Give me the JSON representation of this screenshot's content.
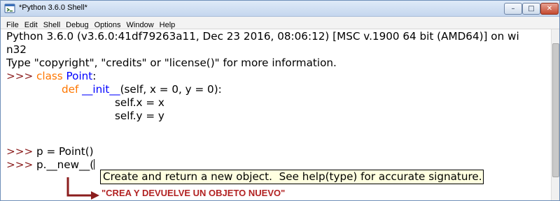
{
  "window": {
    "title": "*Python 3.6.0 Shell*",
    "buttons": {
      "minimize": "–",
      "maximize": "□",
      "close": "✕"
    }
  },
  "menu": [
    "File",
    "Edit",
    "Shell",
    "Debug",
    "Options",
    "Window",
    "Help"
  ],
  "shell": {
    "banner_line1": "Python 3.6.0 (v3.6.0:41df79263a11, Dec 23 2016, 08:06:12) [MSC v.1900 64 bit (AMD64)] on wi",
    "banner_line2": "n32",
    "banner_line3": "Type \"copyright\", \"credits\" or \"license()\" for more information.",
    "prompt": ">>> ",
    "line_class_kw": "class",
    "line_class_name": "Point",
    "line_class_colon": ":",
    "line_def_kw": "def",
    "line_def_name": "__init__",
    "line_def_args": "(self, x = 0, y = 0):",
    "line_body1": "self.x = x",
    "line_body2": "self.y = y",
    "line_assign": "p = Point()",
    "line_new": "p.__new__("
  },
  "calltip": "Create and return a new object.  See help(type) for accurate signature.",
  "annotation": "\"CREA Y DEVUELVE UN OBJETO NUEVO\"",
  "colors": {
    "prompt": "#8b1d1d",
    "keyword": "#ff7700",
    "definition": "#0000ff",
    "calltip_background": "#ffffe0",
    "annotation": "#b22222"
  }
}
